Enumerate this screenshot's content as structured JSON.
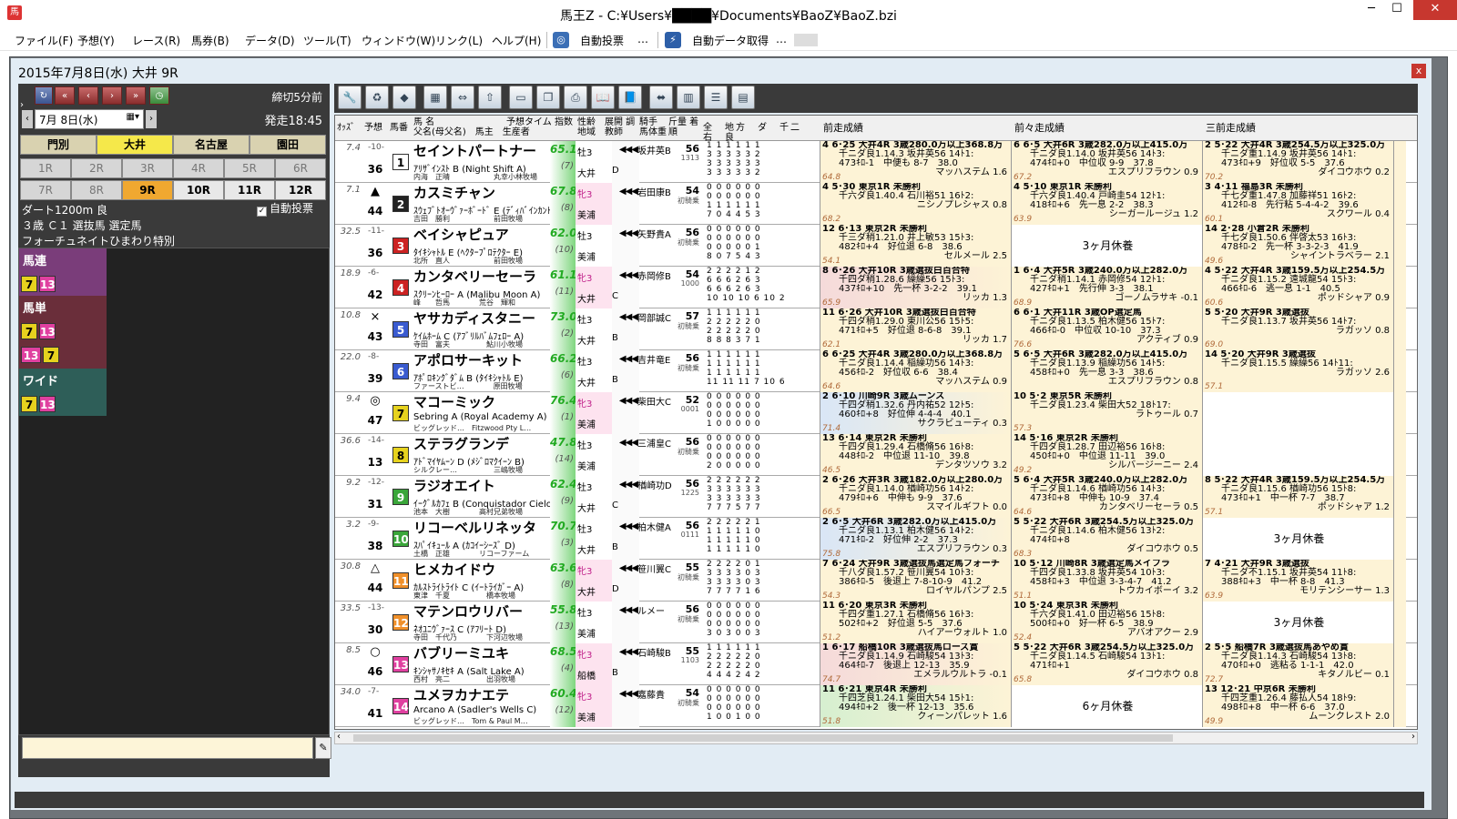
{
  "window": {
    "title": "馬王Z - C:¥Users¥████¥Documents¥BaoZ¥BaoZ.bzi",
    "min": "─",
    "max": "☐",
    "close": "✕"
  },
  "menu": [
    {
      "label": "ファイル(F)"
    },
    {
      "label": "予想(Y)"
    },
    {
      "label": "レース(R)"
    },
    {
      "label": "馬券(B)"
    },
    {
      "label": "データ(D)"
    },
    {
      "label": "ツール(T)"
    },
    {
      "label": "ウィンドウ(W)"
    },
    {
      "label": "リンク(L)"
    },
    {
      "label": "ヘルプ(H)"
    }
  ],
  "menu_extra": {
    "auto_vote": "自動投票",
    "auto_data": "自動データ取得",
    "dots": "…"
  },
  "child": {
    "title": "2015年7月8日(水) 大井 9R",
    "close": "x"
  },
  "nav": {
    "date": "7月 8日(水)",
    "deadline": "締切5分前",
    "post_time": "発走18:45"
  },
  "venues": [
    "門別",
    "大井",
    "名古屋",
    "園田"
  ],
  "races": [
    "1R",
    "2R",
    "3R",
    "4R",
    "5R",
    "6R",
    "7R",
    "8R",
    "9R",
    "10R",
    "11R",
    "12R"
  ],
  "race_info": {
    "course": "ダート1200m 良",
    "cls": "３歳 Ｃ１ 選抜馬 選定馬",
    "name": "フォーチュネイトひまわり特別",
    "auto_vote": "自動投票"
  },
  "bets": [
    {
      "type": "馬連",
      "combos": [
        [
          "7",
          "13"
        ]
      ],
      "color": "#7a3d7a"
    },
    {
      "type": "馬単",
      "combos": [
        [
          "7",
          "13"
        ],
        [
          "13",
          "7"
        ]
      ],
      "color": "#6a2e3a"
    },
    {
      "type": "ワイド",
      "combos": [
        [
          "7",
          "13"
        ]
      ],
      "color": "#2e5e58"
    }
  ],
  "headers": {
    "odds": "ｵｯｽﾞ",
    "pred": "予想",
    "ban": "馬番",
    "name": "馬 名",
    "parents": "父名(母父名)　馬主　生産者",
    "pred_time": "予想タイム 指数",
    "sex": "性齢 地域",
    "cond": "展開 調教師",
    "jockey": "騎手 馬体重",
    "weight": "斤量 着順",
    "stats": "全　地方　ダ　千二　右　良",
    "prev1": "前走成績",
    "prev2": "前々走成績",
    "prev3": "三前走成績"
  },
  "horses": [
    {
      "odds": "7.4",
      "rank": "-10-",
      "mark": "",
      "pop": "36",
      "num": "1",
      "name": "セイントパートナー",
      "sire": "ｱﾘｻﾞｲﾝｽﾄ B (Night Shift A)",
      "breed": "内海　正晴　　　　　　丸幸小林牧場",
      "idx": "65.1",
      "idxr": "(7)",
      "sex": "牡3",
      "area": "大井",
      "trainer": "月岡健D",
      "jockey": "坂井英B",
      "wt": "56",
      "kg": "1313",
      "st": [
        "1 1 1 1 1 1",
        "3 3 3 3 3 2",
        "3 3 3 3 3 3",
        "3 3 3 3 3 2"
      ],
      "p1": [
        "4 6･25 大井4R 3歳280.0万以上368.8万",
        "千ニダ良1.14.3 坂井英56 14ﾄ1:",
        "473ｷﾛ-1　中便も 8-7　38.0",
        "マッハステム 1.6"
      ],
      "p1r": "64.8",
      "p2": [
        "6 6･5 大井6R 3歳282.0万以上415.0万",
        "千ニダ良1.14.0 坂井英56 14ﾄ3:",
        "474ｷﾛ+0　中位収 9-9　37.8",
        "エスプリフラウン 0.9"
      ],
      "p2r": "67.2",
      "p3": [
        "2 5･22 大井4R 3歳254.5万以上325.0万",
        "千ニダ重1.14.9 坂井英56 14ﾄ1:",
        "473ｷﾛ+9　好位収 5-5　37.6",
        "ダイコウホウ 0.2"
      ],
      "p3r": "70.2",
      "g": "",
      "fem": false
    },
    {
      "odds": "7.1",
      "rank": "",
      "mark": "▲",
      "pop": "44",
      "num": "2",
      "name": "カスミチャン",
      "sire": "ｽｳｪﾌﾞﾄｵｰｳﾞｧｰﾎﾞｰﾄﾞ E (ﾃﾞｨﾊﾞｲﾝｶﾝﾄﾘｰ C)",
      "breed": "吉田　勝利　　　　　　前田牧場",
      "idx": "67.8",
      "idxr": "(8)",
      "sex": "牝3",
      "area": "美浦",
      "trainer": "奥村武",
      "jockey": "岩田康B",
      "wt": "54",
      "kg": "初騎乗",
      "st": [
        "0 0 0 0 0 0",
        "0 0 0 0 0 0",
        "1 1 1 1 1 1",
        "7 0 4 4 5 3"
      ],
      "p1": [
        "4 5･30 東京1R 未勝利",
        "千六ダ良1.40.4 石川裕51 16ﾄ2:",
        "",
        "ニシノプレシャス 0.8"
      ],
      "p1r": "68.2",
      "p2": [
        "4 5･10 東京1R 未勝利",
        "千六ダ良1.40.4 戸崎圭54 12ﾄ1:",
        "418ｷﾛ+6　先一息 2-2　38.3",
        "シーガールージュ 1.2"
      ],
      "p2r": "63.9",
      "p3": [
        "3 4･11 福島3R 未勝利",
        "千七ダ重1.47.8 加藤祥51 16ﾄ2:",
        "412ｷﾛ-8　先行粘 5-4-4-2　39.6",
        "スクワール 0.4"
      ],
      "p3r": "60.1",
      "g": "",
      "fem": true
    },
    {
      "odds": "32.5",
      "rank": "-11-",
      "mark": "",
      "pop": "36",
      "num": "3",
      "name": "ベイシャピュア",
      "sire": "ﾀｲｷｼｬﾄﾙ E (ﾍｸﾀｰﾌﾟﾛﾃｸﾀｰ E)",
      "breed": "北所　直人　　　　　　前田牧場",
      "idx": "62.0",
      "idxr": "(10)",
      "sex": "牡3",
      "area": "美浦",
      "trainer": "本間忍",
      "jockey": "矢野貴A",
      "wt": "56",
      "kg": "初騎乗",
      "st": [
        "0 0 0 0 0 0",
        "0 0 0 0 0 0",
        "0 0 0 0 0 1",
        "8 0 7 5 4 3"
      ],
      "p1": [
        "12 6･13 東京2R 未勝利",
        "千三ダ稍1.21.0 井上敏53 15ﾄ3:",
        "482ｷﾛ+4　好位退 6-8　38.6",
        "セルメール 2.5"
      ],
      "p1r": "54.1",
      "p2": "rest:3ヶ月休養",
      "p2r": "",
      "p3": [
        "14 2･28 小倉2R 未勝利",
        "千七ダ良1.50.6 伴啓太53 16ﾄ3:",
        "478ｷﾛ-2　先一杯 3-3-2-3　41.9",
        "シャイントラベラー 2.1"
      ],
      "p3r": "49.6",
      "g": "",
      "fem": false
    },
    {
      "odds": "18.9",
      "rank": "-6-",
      "mark": "",
      "pop": "42",
      "num": "4",
      "name": "カンタベリーセーラ",
      "sire": "ｽｸﾘｰﾝﾋｰﾛｰ A (Malibu Moon A)",
      "breed": "峰　　哲馬　　　　荒谷　輝和",
      "idx": "61.1",
      "idxr": "(11)",
      "sex": "牝3",
      "area": "大井",
      "trainer": "遠藤茂C",
      "jockey": "赤岡修B",
      "wt": "54",
      "kg": "1000",
      "st": [
        "2 2 2 2 1 2",
        "6 6 6 2 6 3",
        "6 6 6 2 6 3",
        "10 10 10 6 10 2"
      ],
      "p1": [
        "8 6･26 大井10R 3歳選抜白百合特",
        "千四ダ稍1.28.6 繰繰56 15ﾄ3:",
        "437ｷﾛ+10　先一杯 3-2-2　39.1",
        "リッカ 1.3"
      ],
      "p1r": "65.9",
      "p2": [
        "1 6･4 大井5R 3歳240.0万以上282.0万",
        "千ニダ稍1.14.1 赤岡修54 12ﾄ1:",
        "427ｷﾛ+1　先行伸 3-3　38.1",
        "ゴーノムラサキ -0.1"
      ],
      "p2r": "68.9",
      "p3": [
        "4 5･22 大井4R 3歳159.5万以上254.5万",
        "千ニダ良1.15.2 遠城龍54 15ﾄ3:",
        "466ｷﾛ-6　逃一息 1-1　40.5",
        "ポッドシャア 0.9"
      ],
      "p3r": "60.6",
      "g": "g3",
      "fem": true
    },
    {
      "odds": "10.8",
      "rank": "",
      "mark": "×",
      "pop": "43",
      "num": "5",
      "name": "ヤサカディスタニー",
      "sire": "ｹｲﾑﾎｰﾑ C (ｱﾌﾞﾘﾙﾊﾞﾑﾌｪﾛｰ A)",
      "breed": "寺田　富夫　　　　　鮎川小牧場",
      "idx": "73.0",
      "idxr": "(2)",
      "sex": "牡3",
      "area": "大井",
      "trainer": "腰見浩B",
      "jockey": "岡部誠C",
      "wt": "57",
      "kg": "初騎乗",
      "st": [
        "1 1 1 1 1 1",
        "2 2 2 2 2 0",
        "2 2 2 2 2 0",
        "8 8 8 3 7 1"
      ],
      "p1": [
        "11 6･26 大井10R 3歳選抜白百合特",
        "千四ダ稍1.29.0 東川公56 15ﾄ5:",
        "471ｷﾛ+5　好位退 8-6-8　39.1",
        "リッカ 1.7"
      ],
      "p1r": "62.1",
      "p2": [
        "6 6･1 大井11R 3歳OP選定馬",
        "千ニダ良1.13.5 柏木健56 15ﾄ7:",
        "466ｷﾛ-0　中位収 10-10　37.3",
        "アクティブ 0.9"
      ],
      "p2r": "76.6",
      "p3": [
        "5 5･20 大井9R 3歳選抜",
        "千ニダ良1.13.7 坂井英56 14ﾄ7:",
        "",
        "ラガッソ 0.8"
      ],
      "p3r": "69.0",
      "g": "",
      "fem": false
    },
    {
      "odds": "22.0",
      "rank": "-8-",
      "mark": "",
      "pop": "39",
      "num": "6",
      "name": "アポロサーキット",
      "sire": "ｱﾎﾟﾛｷﾝｸﾞﾀﾞﾑ B (ﾀｲｷｼｬﾄﾙ E)",
      "breed": "ファーストビ…　　　　原田牧場",
      "idx": "66.2",
      "idxr": "(6)",
      "sex": "牡3",
      "area": "大井",
      "trainer": "朝倉実B",
      "jockey": "吉井竜E",
      "wt": "56",
      "kg": "初騎乗",
      "st": [
        "1 1 1 1 1 1",
        "1 1 1 1 1 1",
        "1 1 1 1 1 1",
        "11 11 11 7 10 6"
      ],
      "p1": [
        "6 6･25 大井4R 3歳280.0万以上368.8万",
        "千ニダ良1.14.4 稲繰功56 14ﾄ3:",
        "456ｷﾛ-2　好位収 6-6　38.4",
        "マッハステム 0.9"
      ],
      "p1r": "64.6",
      "p2": [
        "5 6･5 大井6R 3歳282.0万以上415.0万",
        "千ニダ良1.13.9 稲繰功56 14ﾄ5:",
        "458ｷﾛ+0　先一息 3-3　38.6",
        "エスプリフラウン 0.8"
      ],
      "p2r": "",
      "p3": [
        "14 5･20 大井9R 3歳選抜",
        "千ニダ良1.15.5 繰繰56 14ﾄ11:",
        "",
        "ラガッソ 2.6"
      ],
      "p3r": "57.1",
      "g": "",
      "fem": false
    },
    {
      "odds": "9.4",
      "rank": "",
      "mark": "◎",
      "pop": "47",
      "num": "7",
      "name": "マコーミック",
      "sire": "Sebring A (Royal Academy A)",
      "breed": "ビッグレッド…　Fitzwood Pty L…",
      "idx": "76.4",
      "idxr": "(1)",
      "sex": "牝3",
      "area": "美浦",
      "trainer": "清水英",
      "jockey": "柴田大C",
      "wt": "52",
      "kg": "0001",
      "st": [
        "0 0 0 0 0 0",
        "0 0 0 0 0 0",
        "0 0 0 0 0 0",
        "1 0 0 0 0 0"
      ],
      "p1": [
        "2 6･10 川崎9R 3歳ムーンス",
        "千四ダ稍1.32.6 丹内祐52 12ﾄ5:",
        "460ｷﾛ+8　好位伸 4-4-4　40.1",
        "サクラビューティ 0.3"
      ],
      "p1r": "71.4",
      "p2": [
        "10 5･2 東京5R 未勝利",
        "千二ダ良1.23.4 柴田大52 18ﾄ17:",
        "",
        "ラトゥール 0.7"
      ],
      "p2r": "57.3",
      "p3": "rest:",
      "p3r": "",
      "g": "g2",
      "fem": true
    },
    {
      "odds": "36.6",
      "rank": "-14-",
      "mark": "",
      "pop": "13",
      "num": "8",
      "name": "ステラグランデ",
      "sire": "ｱﾄﾞﾏｲﾔﾑｰﾝ D (ﾒｼﾞﾛﾏｸｲｰﾝ B)",
      "breed": "シルクレー…　　　　　三嶋牧場",
      "idx": "47.8",
      "idxr": "(14)",
      "sex": "牡3",
      "area": "美浦",
      "trainer": "田村康",
      "jockey": "三浦皇C",
      "wt": "56",
      "kg": "初騎乗",
      "st": [
        "0 0 0 0 0 0",
        "0 0 0 0 0 0",
        "0 0 0 0 0 0",
        "2 0 0 0 0 0"
      ],
      "p1": [
        "13 6･14 東京2R 未勝利",
        "千四ダ良1.29.4 石橋脩56 16ﾄ8:",
        "448ｷﾛ-2　中位退 11-10　39.8",
        "デンタツソウ 3.2"
      ],
      "p1r": "46.5",
      "p2": [
        "14 5･16 東京2R 未勝利",
        "千四ダ良1.28.7 田辺裕56 16ﾄ8:",
        "450ｷﾛ+0　中位退 11-11　39.0",
        "シルバージーニー 2.4"
      ],
      "p2r": "49.2",
      "p3": "rest:",
      "p3r": "",
      "g": "",
      "fem": false
    },
    {
      "odds": "9.2",
      "rank": "-12-",
      "mark": "",
      "pop": "31",
      "num": "9",
      "name": "ラジオエイト",
      "sire": "ｲｰｸﾞﾙｶﾌｪ B (Conquistador Cielo A)",
      "breed": "池本　大樹　　　　高村兄弟牧場",
      "idx": "62.4",
      "idxr": "(9)",
      "sex": "牡3",
      "area": "大井",
      "trainer": "澤佳宗C",
      "jockey": "楢崎功D",
      "wt": "56",
      "kg": "1225",
      "st": [
        "2 2 2 2 2 2",
        "3 3 3 3 3 3",
        "3 3 3 3 3 3",
        "7 7 7 5 7 7"
      ],
      "p1": [
        "2 6･26 大井3R 3歳182.0万以上280.0万",
        "千ニダ良1.14.0 楢崎功56 14ﾄ2:",
        "479ｷﾛ+6　中伸も 9-9　37.6",
        "スマイルギフト 0.0"
      ],
      "p1r": "66.5",
      "p2": [
        "5 6･4 大井5R 3歳240.0万以上282.0万",
        "千ニダ良1.14.6 楢崎功56 14ﾄ3:",
        "473ｷﾛ+8　中伸も 10-9　37.4",
        "カンタベリーセーラ 0.5"
      ],
      "p2r": "64.6",
      "p3": [
        "8 5･22 大井4R 3歳159.5万以上254.5万",
        "千ニダ良1.15.6 楢崎功56 15ﾄ8:",
        "473ｷﾛ+1　中一杯 7-7　38.7",
        "ポッドシャア 1.2"
      ],
      "p3r": "57.1",
      "g": "",
      "fem": false
    },
    {
      "odds": "3.2",
      "rank": "-9-",
      "mark": "",
      "pop": "38",
      "num": "10",
      "name": "リコーベルリネッタ",
      "sire": "ｽﾊﾟｲｷｭｰﾙ A (ｶｺｲｰｼｰｽﾞ D)",
      "breed": "土橋　正雄　　　　リコーファーム",
      "idx": "70.7",
      "idxr": "(3)",
      "sex": "牡3",
      "area": "大井",
      "trainer": "蛯名雄B",
      "jockey": "柏木健A",
      "wt": "56",
      "kg": "0111",
      "st": [
        "2 2 2 2 2 1",
        "1 1 1 1 1 0",
        "1 1 1 1 1 0",
        "1 1 1 1 1 0"
      ],
      "p1": [
        "2 6･5 大井6R 3歳282.0万以上415.0万",
        "千ニダ良1.13.1 柏木健56 14ﾄ2:",
        "471ｷﾛ-2　好位伸 2-2　37.3",
        "エスプリフラウン 0.3"
      ],
      "p1r": "75.8",
      "p2": [
        "5 5･22 大井6R 3歳254.5万以上325.0万",
        "千ニダ良1.14.6 柏木健56 13ﾄ2:",
        "474ｷﾛ+8　",
        "ダイコウホウ 0.5"
      ],
      "p2r": "68.3",
      "p3": "rest:3ヶ月休養",
      "p3r": "",
      "g": "g2",
      "fem": false
    },
    {
      "odds": "30.8",
      "rank": "",
      "mark": "△",
      "pop": "44",
      "num": "11",
      "name": "ヒメカイドウ",
      "sire": "ｶﾙｽﾄﾗｲﾄﾗｲﾄ C (ｲｰﾄﾗｲｶﾞｰ A)",
      "breed": "東津　千夏　　　　　橋本牧場",
      "idx": "63.6",
      "idxr": "(8)",
      "sex": "牝3",
      "area": "大井",
      "trainer": "上杉昌D",
      "jockey": "笹川翼C",
      "wt": "55",
      "kg": "初騎乗",
      "st": [
        "2 2 2 2 0 1",
        "3 3 3 3 0 3",
        "3 3 3 3 0 3",
        "7 7 7 7 1 6"
      ],
      "p1": [
        "7 6･24 大井9R 3歳選抜馬選定馬フォーチ",
        "千八ダ良1.57.2 笹川翼54 10ﾄ3:",
        "386ｷﾛ-5　後退上 7-8-10-9　41.2",
        "ロイヤルパンプ 2.5"
      ],
      "p1r": "54.3",
      "p2": [
        "10 5･12 川崎8R 3歳選定馬メイフラ",
        "千四ダ良1.33.8 坂井英54 10ﾄ3:",
        "458ｷﾛ+3　中位退 3-3-4-7　41.2",
        "トウカイボーイ 3.2"
      ],
      "p2r": "51.1",
      "p3": [
        "7 4･21 大井9R 3歳選抜",
        "千ニダ不1.15.1 坂井英54 11ﾄ8:",
        "388ｷﾛ+3　中一杯 8-8　41.3",
        "モリテンシーサー 1.3"
      ],
      "p3r": "63.9",
      "g": "",
      "fem": true
    },
    {
      "odds": "33.5",
      "rank": "-13-",
      "mark": "",
      "pop": "30",
      "num": "12",
      "name": "マテンロウリバー",
      "sire": "ﾈｵﾕﾆｳﾞｧｰｽ C (ｱﾌﾘｰﾄ D)",
      "breed": "寺田　千代乃　　　　下河辺牧場",
      "idx": "55.8",
      "idxr": "(13)",
      "sex": "牡3",
      "area": "美浦",
      "trainer": "田村康",
      "jockey": "ルメー",
      "wt": "56",
      "kg": "初騎乗",
      "st": [
        "0 0 0 0 0 0",
        "0 0 0 0 0 0",
        "0 0 0 0 0 0",
        "3 0 3 0 0 3"
      ],
      "p1": [
        "11 6･20 東京3R 未勝利",
        "千四ダ重1.27.1 石橋脩56 16ﾄ3:",
        "502ｷﾛ+2　好位退 5-5　37.6",
        "ハイアーウォルト 1.0"
      ],
      "p1r": "51.2",
      "p2": [
        "10 5･24 東京3R 未勝利",
        "千六ダ良1.41.0 田辺裕56 15ﾄ8:",
        "500ｷﾛ+0　好一杯 6-5　38.9",
        "アバオアクー 2.9"
      ],
      "p2r": "52.4",
      "p3": "rest:3ヶ月休養",
      "p3r": "",
      "g": "",
      "fem": false
    },
    {
      "odds": "8.5",
      "rank": "",
      "mark": "○",
      "pop": "46",
      "num": "13",
      "name": "バブリーミユキ",
      "sire": "ｷﾝｼｬｻﾉｷｾｷ A (Salt Lake A)",
      "breed": "西村　亮二　　　　　出羽牧場",
      "idx": "68.5",
      "idxr": "(4)",
      "sex": "牝3",
      "area": "船橋",
      "trainer": "矢野義B",
      "jockey": "石崎駿B",
      "wt": "55",
      "kg": "1103",
      "st": [
        "1 1 1 1 1 1",
        "2 2 2 2 2 0",
        "2 2 2 2 2 0",
        "4 4 4 2 4 2"
      ],
      "p1": [
        "1 6･17 船橋10R 3歳選抜馬ローズ賞",
        "千ニダ良1.14.9 石崎駿54 13ﾄ3:",
        "464ｷﾛ-7　後退上 12-13　35.9",
        "エメラルウルトラ -0.1"
      ],
      "p1r": "74.7",
      "p2": [
        "5 5･22 大井6R 3歳254.5万以上325.0万",
        "千ニダ良1.14.5 石崎駿54 13ﾄ1:",
        "471ｷﾛ+1　",
        "ダイコウホウ 0.8"
      ],
      "p2r": "65.8",
      "p3": [
        "2 5･5 船橋7R 3歳選抜馬あやめ賞",
        "千ニダ良1.14.3 石崎駿54 13ﾄ8:",
        "470ｷﾛ+0　逃粘る 1-1-1　42.0",
        "キタノルビー 0.1"
      ],
      "p3r": "72.7",
      "g": "g3",
      "fem": true
    },
    {
      "odds": "34.0",
      "rank": "-7-",
      "mark": "",
      "pop": "41",
      "num": "14",
      "name": "ユメヲカナエテ",
      "sire": "Arcano A (Sadler's Wells C)",
      "breed": "ビッグレッド…　Tom & Paul M…",
      "idx": "60.4",
      "idxr": "(12)",
      "sex": "牝3",
      "area": "美浦",
      "trainer": "田中清",
      "jockey": "嘉藤貴",
      "wt": "54",
      "kg": "初騎乗",
      "st": [
        "0 0 0 0 0 0",
        "0 0 0 0 0 0",
        "0 0 0 0 0 0",
        "1 0 0 1 0 0"
      ],
      "p1": [
        "11 6･21 東京4R 未勝利",
        "千四芝良1.24.1 柴田大54 15ﾄ1:",
        "494ｷﾛ+2　後一杯 12-13　35.6",
        "クィーンパレット 1.6"
      ],
      "p1r": "51.8",
      "p2": "rest:6ヶ月休養",
      "p2r": "",
      "p3": [
        "13 12･21 中京6R 未勝利",
        "千四芝重1.26.4 藤払人54 18ﾄ9:",
        "498ｷﾛ+8　中一杯 6-6　37.0",
        "ムーンクレスト 2.0"
      ],
      "p3r": "49.9",
      "g": "g1",
      "fem": true
    }
  ],
  "colors": {
    "frame": [
      "#ffffff",
      "#222222",
      "#cc2222",
      "#cc2222",
      "#3a5bd0",
      "#3a5bd0",
      "#e6d21e",
      "#e6d21e",
      "#3aa63a",
      "#3aa63a",
      "#f0902a",
      "#f0902a",
      "#e040a0",
      "#e040a0"
    ],
    "accent": "#f5e84a",
    "race_selected": "#f0a830"
  }
}
